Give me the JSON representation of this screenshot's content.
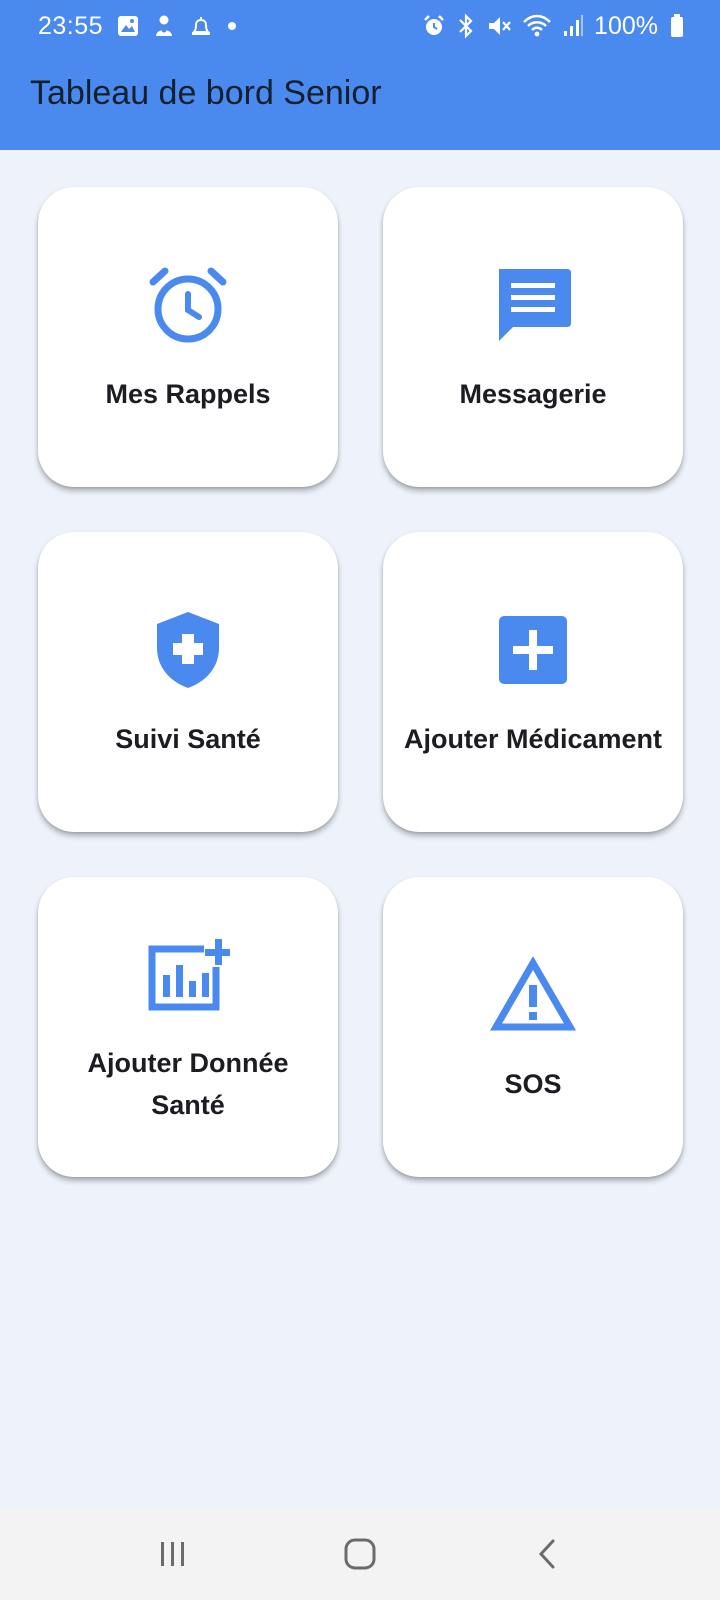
{
  "status_bar": {
    "time": "23:55",
    "battery": "100%",
    "left_icons": [
      "image-icon",
      "person-icon",
      "bell-icon",
      "dot-icon"
    ],
    "right_icons": [
      "alarm-icon",
      "bluetooth-icon",
      "mute-icon",
      "wifi-icon",
      "signal-icon",
      "battery-icon"
    ]
  },
  "app_bar": {
    "title": "Tableau de bord Senior"
  },
  "tiles": [
    {
      "label": "Mes Rappels",
      "icon": "alarm-clock-icon"
    },
    {
      "label": "Messagerie",
      "icon": "message-icon"
    },
    {
      "label": "Suivi Santé",
      "icon": "shield-plus-icon"
    },
    {
      "label": "Ajouter Médicament",
      "icon": "add-box-icon"
    },
    {
      "label": "Ajouter Donnée Santé",
      "icon": "chart-add-icon"
    },
    {
      "label": "SOS",
      "icon": "warning-icon"
    }
  ],
  "nav_bar": {
    "buttons": [
      "recent-apps-icon",
      "home-icon",
      "back-icon"
    ]
  },
  "colors": {
    "accent": "#4a89ee",
    "background": "#eef3fb",
    "tile": "#ffffff",
    "title_text": "#15202f"
  }
}
